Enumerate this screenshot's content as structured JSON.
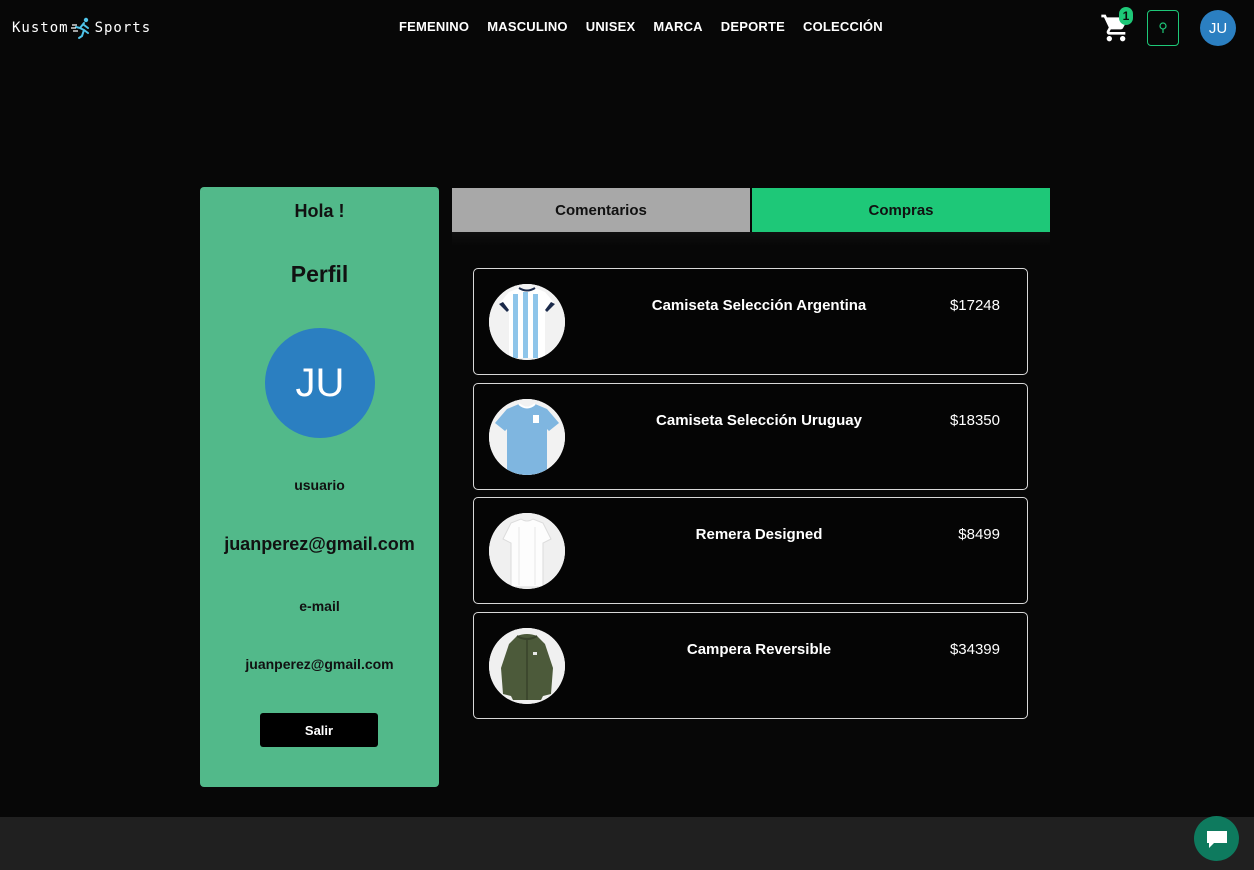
{
  "brand": {
    "left": "Kustom",
    "right": "Sports"
  },
  "nav": {
    "items": [
      "FEMENINO",
      "MASCULINO",
      "UNISEX",
      "MARCA",
      "DEPORTE",
      "COLECCIÓN"
    ]
  },
  "header": {
    "cart_count": "1",
    "avatar_initials": "JU"
  },
  "profile": {
    "greeting": "Hola !",
    "title": "Perfil",
    "avatar_initials": "JU",
    "user_label": "usuario",
    "user_value": "juanperez@gmail.com",
    "email_label": "e-mail",
    "email_value": "juanperez@gmail.com",
    "logout_label": "Salir"
  },
  "tabs": {
    "comments": "Comentarios",
    "purchases": "Compras",
    "active": "purchases"
  },
  "purchases": [
    {
      "name": "Camiseta Selección Argentina",
      "price": "$17248",
      "thumb": "jersey-argentina"
    },
    {
      "name": "Camiseta Selección Uruguay",
      "price": "$18350",
      "thumb": "jersey-uruguay"
    },
    {
      "name": "Remera Designed",
      "price": "$8499",
      "thumb": "tshirt-white"
    },
    {
      "name": "Campera Reversible",
      "price": "$34399",
      "thumb": "jacket-olive"
    }
  ],
  "colors": {
    "accent": "#1ec878",
    "profile_bg": "#52b98a",
    "avatar_bg": "#2b7fc1",
    "tab_inactive": "#a8a8a8",
    "chat_bg": "#0e7a5e"
  }
}
